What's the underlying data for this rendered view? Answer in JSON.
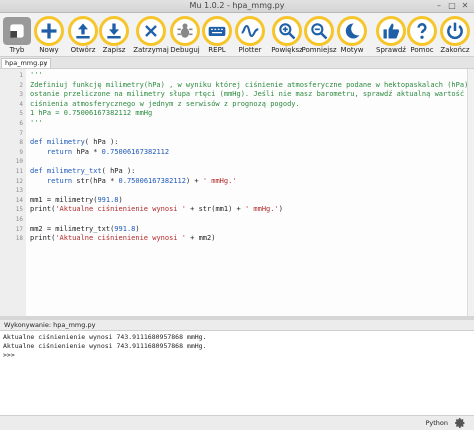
{
  "window": {
    "title": "Mu 1.0.2 - hpa_mmg.py"
  },
  "toolbar": [
    {
      "label": "Tryb",
      "icon": "mode-icon"
    },
    {
      "label": "Nowy",
      "icon": "plus-icon"
    },
    {
      "label": "Otwórz",
      "icon": "open-icon"
    },
    {
      "label": "Zapisz",
      "icon": "save-icon"
    },
    {
      "label": "Zatrzymaj",
      "icon": "stop-icon"
    },
    {
      "label": "Debuguj",
      "icon": "bug-icon"
    },
    {
      "label": "REPL",
      "icon": "keyboard-icon"
    },
    {
      "label": "Plotter",
      "icon": "plotter-icon"
    },
    {
      "label": "Powiększ",
      "icon": "zoom-in-icon"
    },
    {
      "label": "Pomniejsz",
      "icon": "zoom-out-icon"
    },
    {
      "label": "Motyw",
      "icon": "theme-icon"
    },
    {
      "label": "Sprawdź",
      "icon": "thumbs-up-icon"
    },
    {
      "label": "Pomoc",
      "icon": "help-icon"
    },
    {
      "label": "Zakończ",
      "icon": "quit-icon"
    }
  ],
  "tab": {
    "label": "hpa_mmg.py",
    "close": "×"
  },
  "editor": {
    "lines": [
      {
        "n": "1",
        "parts": [
          {
            "t": "'''",
            "c": "doc"
          }
        ]
      },
      {
        "n": "2",
        "parts": [
          {
            "t": "Zdefiniuj funkcję milimetry(hPa) , w wyniku której ciśnienie atmosferyczne podane w hektopaskalach (hPa)",
            "c": "doc"
          }
        ]
      },
      {
        "n": "3",
        "parts": [
          {
            "t": "ostanie przeliczone na milimetry słupa rtęci (mmHg). Jeśli nie masz barometru, sprawdź aktualną wartość",
            "c": "doc"
          }
        ]
      },
      {
        "n": "4",
        "parts": [
          {
            "t": "ciśnienia atmosferycznego w jednym z serwisów z prognozą pogody.",
            "c": "doc"
          }
        ]
      },
      {
        "n": "5",
        "parts": [
          {
            "t": "1 hPa = 0.75006167382112 mmHg",
            "c": "doc"
          }
        ]
      },
      {
        "n": "6",
        "parts": [
          {
            "t": "'''",
            "c": "doc"
          }
        ]
      },
      {
        "n": "7",
        "parts": []
      },
      {
        "n": "8",
        "parts": [
          {
            "t": "def ",
            "c": "kw"
          },
          {
            "t": "milimetry",
            "c": "fn"
          },
          {
            "t": "( hPa ):",
            "c": "plain"
          }
        ]
      },
      {
        "n": "9",
        "parts": [
          {
            "t": "    ",
            "c": "plain"
          },
          {
            "t": "return ",
            "c": "kw"
          },
          {
            "t": "hPa * ",
            "c": "plain"
          },
          {
            "t": "0.75006167382112",
            "c": "num"
          }
        ]
      },
      {
        "n": "10",
        "parts": []
      },
      {
        "n": "11",
        "parts": [
          {
            "t": "def ",
            "c": "kw"
          },
          {
            "t": "milimetry_txt",
            "c": "fn"
          },
          {
            "t": "( hPa ):",
            "c": "plain"
          }
        ]
      },
      {
        "n": "12",
        "parts": [
          {
            "t": "    ",
            "c": "plain"
          },
          {
            "t": "return ",
            "c": "kw"
          },
          {
            "t": "str(hPa * ",
            "c": "plain"
          },
          {
            "t": "0.75006167382112",
            "c": "num"
          },
          {
            "t": ") + ",
            "c": "plain"
          },
          {
            "t": "' mmHg.'",
            "c": "str"
          }
        ]
      },
      {
        "n": "13",
        "parts": []
      },
      {
        "n": "14",
        "parts": [
          {
            "t": "mm1 = milimetry(",
            "c": "plain"
          },
          {
            "t": "991.8",
            "c": "num"
          },
          {
            "t": ")",
            "c": "plain"
          }
        ]
      },
      {
        "n": "15",
        "parts": [
          {
            "t": "print(",
            "c": "plain"
          },
          {
            "t": "'Aktualne ciśnienienie wynosi '",
            "c": "str"
          },
          {
            "t": " + str(mm1) + ",
            "c": "plain"
          },
          {
            "t": "' mmHg.'",
            "c": "str"
          },
          {
            "t": ")",
            "c": "plain"
          }
        ]
      },
      {
        "n": "16",
        "parts": []
      },
      {
        "n": "17",
        "parts": [
          {
            "t": "mm2 = milimetry_txt(",
            "c": "plain"
          },
          {
            "t": "991.8",
            "c": "num"
          },
          {
            "t": ")",
            "c": "plain"
          }
        ]
      },
      {
        "n": "18",
        "parts": [
          {
            "t": "print(",
            "c": "plain"
          },
          {
            "t": "'Aktualne ciśnienienie wynosi '",
            "c": "str"
          },
          {
            "t": " + mm2)",
            "c": "plain"
          }
        ]
      }
    ]
  },
  "output": {
    "title": "Wykonywanie: hpa_mmg.py",
    "lines": [
      "Aktualne ciśnienienie wynosi 743.9111680957868 mmHg.",
      "Aktualne ciśnienienie wynosi 743.9111680957868 mmHg.",
      ">>>"
    ]
  },
  "status": {
    "mode": "Python",
    "settings_icon": "gear-icon"
  },
  "colors": {
    "button_ring": "#f6c52a",
    "docstring": "#2b8a3e",
    "keyword": "#1e58b8",
    "string": "#b02a2a"
  }
}
